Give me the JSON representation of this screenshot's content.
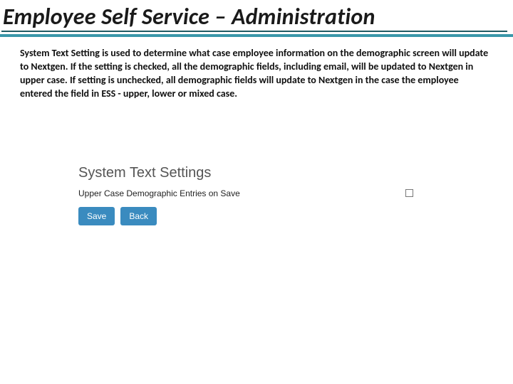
{
  "banner": {
    "title": "Employee Self Service – Administration"
  },
  "description": "System Text Setting is used to determine what case employee information on the demographic screen will update to Nextgen.  If the setting is checked, all the demographic fields, including email, will be updated to Nextgen in upper case.  If setting is unchecked, all demographic fields will update to Nextgen in the case the employee entered the field in ESS - upper, lower or mixed case.",
  "panel": {
    "heading": "System Text Settings",
    "setting_label": "Upper Case Demographic Entries on Save",
    "checked": false,
    "save_label": "Save",
    "back_label": "Back"
  }
}
